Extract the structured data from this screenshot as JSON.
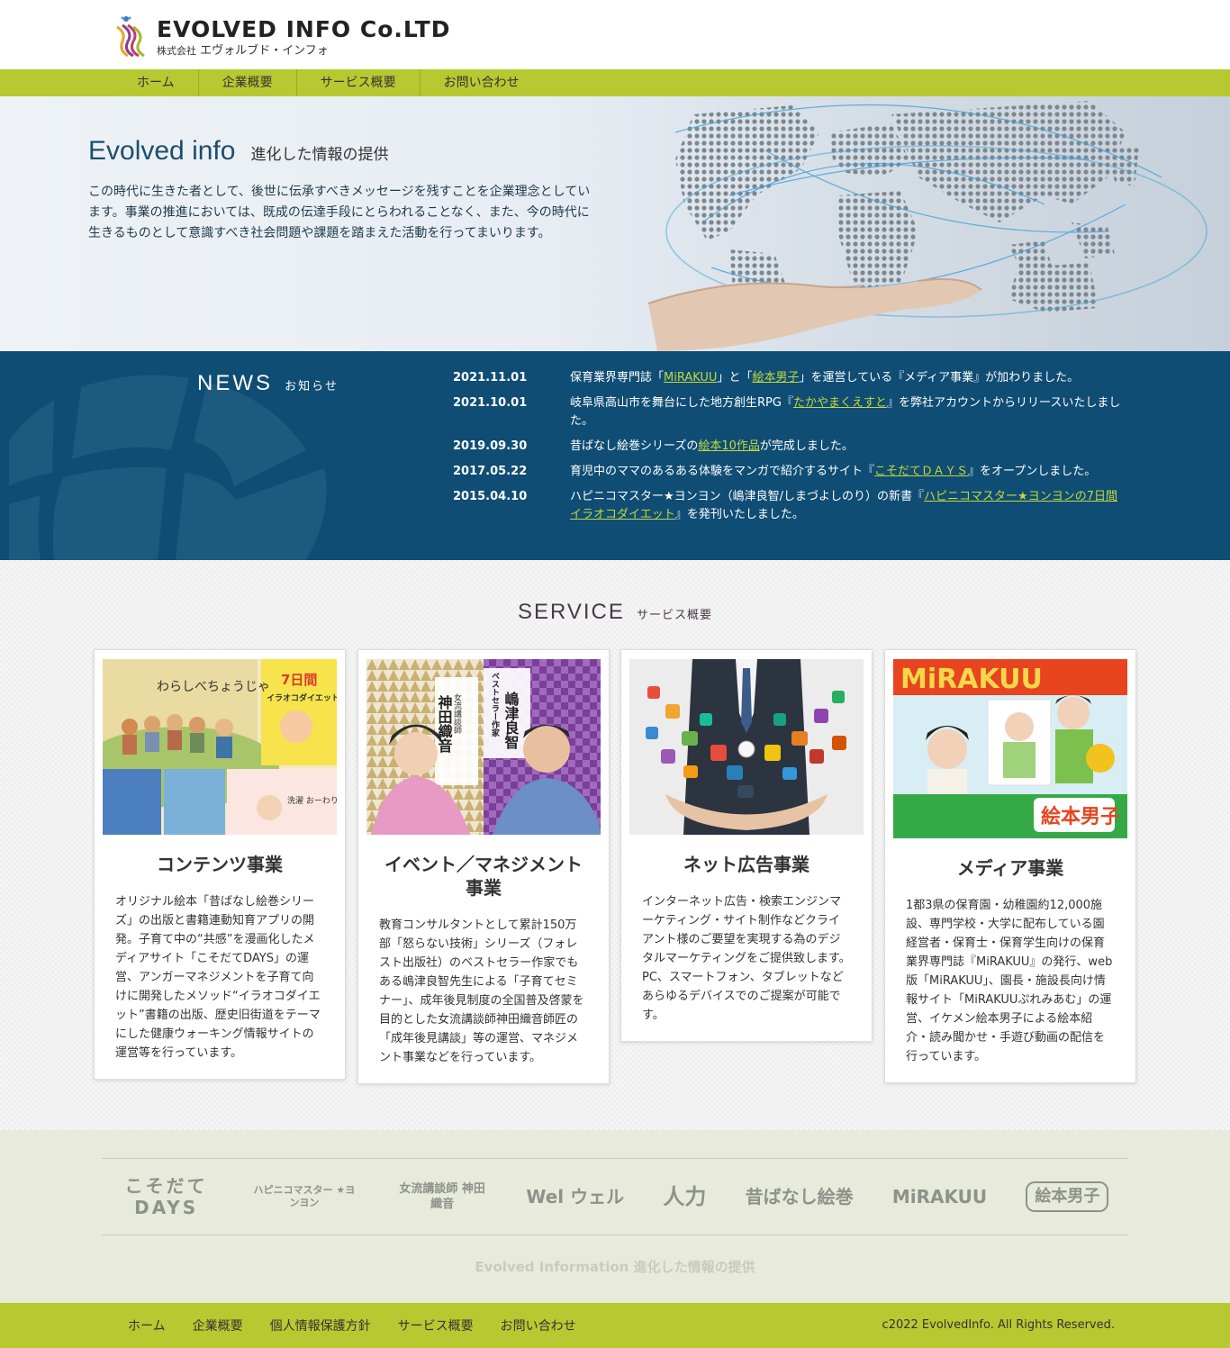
{
  "header": {
    "logo_text": "EVOLVED  INFO Co.LTD",
    "logo_sub_prefix": "株式会社",
    "logo_sub": "エヴォルブド・インフォ"
  },
  "nav": {
    "items": [
      "ホーム",
      "企業概要",
      "サービス概要",
      "お問い合わせ"
    ]
  },
  "hero": {
    "title_en": "Evolved info",
    "title_jp": "進化した情報の提供",
    "text": "この時代に生きた者として、後世に伝承すべきメッセージを残すことを企業理念としています。事業の推進においては、既成の伝達手段にとらわれることなく、また、今の時代に生きるものとして意識すべき社会問題や課題を踏まえた活動を行ってまいります。"
  },
  "news": {
    "heading_en": "NEWS",
    "heading_jp": "お知らせ",
    "items": [
      {
        "date": "2021.11.01",
        "pre": "保育業界専門誌「",
        "link1": "MiRAKUU",
        "mid": "」と「",
        "link2": "絵本男子",
        "post": "」を運営している『メディア事業』が加わりました。"
      },
      {
        "date": "2021.10.01",
        "pre": "岐阜県高山市を舞台にした地方創生RPG『",
        "link1": "たかやまくえすと",
        "mid": "",
        "link2": "",
        "post": "』を弊社アカウントからリリースいたしました。"
      },
      {
        "date": "2019.09.30",
        "pre": "昔ばなし絵巻シリーズの",
        "link1": "絵本10作品",
        "mid": "",
        "link2": "",
        "post": "が完成しました。"
      },
      {
        "date": "2017.05.22",
        "pre": "育児中のママのあるある体験をマンガで紹介するサイト『",
        "link1": "こそだてＤＡＹＳ",
        "mid": "",
        "link2": "",
        "post": "』をオープンしました。"
      },
      {
        "date": "2015.04.10",
        "pre": "ハピニコマスター★ヨンヨン（嶋津良智/しまづよしのり）の新書『",
        "link1": "ハピニコマスター★ヨンヨンの7日間イラオコダイエット",
        "mid": "",
        "link2": "",
        "post": "』を発刊いたしました。"
      }
    ]
  },
  "service": {
    "heading_en": "SERVICE",
    "heading_jp": "サービス概要",
    "cards": [
      {
        "title": "コンテンツ事業",
        "text": "オリジナル絵本「昔ばなし絵巻シリーズ」の出版と書籍連動知育アプリの開発。子育て中の“共感”を漫画化したメディアサイト「こそだてDAYS」の運営、アンガーマネジメントを子育て向けに開発したメソッド“イラオコダイエット”書籍の出版、歴史旧街道をテーマにした健康ウォーキング情報サイトの運営等を行っています。",
        "img_title": "わらしべちょうじゃ",
        "img_badge": "7日間",
        "img_badge_sub": "イラオコダイエット",
        "img_caption": "洗濯 おーわり♪"
      },
      {
        "title": "イベント／マネジメント事業",
        "text": "教育コンサルタントとして累計150万部「怒らない技術」シリーズ（フォレスト出版社）のベストセラー作家でもある嶋津良智先生による「子育てセミナー」、成年後見制度の全国普及啓蒙を目的とした女流講談師神田織音師匠の「成年後見講談」等の運営、マネジメント事業などを行っています。",
        "img_name1": "神田織音",
        "img_name1_label": "女流講談師",
        "img_name2": "嶋津良智",
        "img_name2_label": "ベストセラー作家"
      },
      {
        "title": "ネット広告事業",
        "text": "インターネット広告・検索エンジンマーケティング・サイト制作などクライアント様のご要望を実現する為のデジタルマーケティングをご提供致します。PC、スマートフォン、タブレットなどあらゆるデバイスでのご提案が可能です。"
      },
      {
        "title": "メディア事業",
        "text": "1都3県の保育園・幼稚園約12,000施設、専門学校・大学に配布している園経営者・保育士・保育学生向けの保育業界専門誌『MiRAKUU』の発行、web版「MiRAKUU」、園長・施設長向け情報サイト「MiRAKUUぷれみあむ」の運営、イケメン絵本男子による絵本紹介・読み聞かせ・手遊び動画の配信を行っています。",
        "img_logo": "MiRAKUU",
        "img_badge": "絵本男子"
      }
    ]
  },
  "partners": {
    "logos": [
      "こそだて DAYS",
      "ハピニコマスター ★ヨンヨン",
      "女流講談師 神田織音",
      "Wel ウェル",
      "人力",
      "昔ばなし絵巻",
      "MiRAKUU",
      "絵本男子"
    ],
    "tagline": "Evolved Information 進化した情報の提供"
  },
  "footer": {
    "items": [
      "ホーム",
      "企業概要",
      "個人情報保護方針",
      "サービス概要",
      "お問い合わせ"
    ],
    "copyright": "c2022 EvolvedInfo. All Rights Reserved."
  },
  "colors": {
    "accent": "#b8c831",
    "news_bg": "#0f4d74",
    "link": "#c3d83b",
    "title": "#1b4e6e"
  }
}
